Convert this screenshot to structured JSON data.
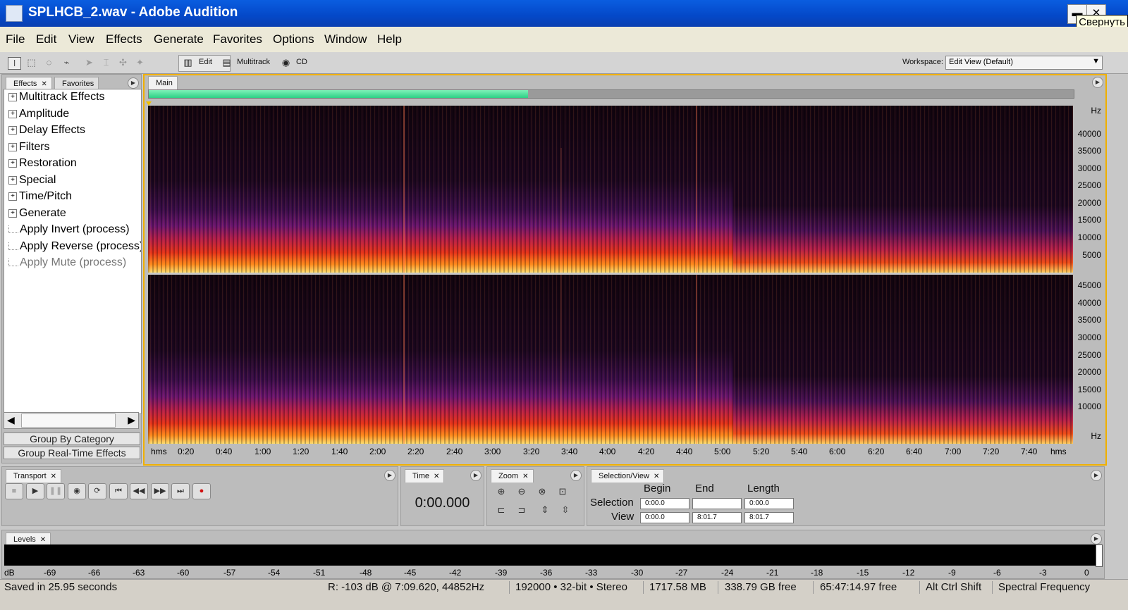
{
  "window": {
    "title": "SPLHCB_2.wav - Adobe Audition",
    "minimize_tooltip": "Свернуть"
  },
  "menu": [
    "File",
    "Edit",
    "View",
    "Effects",
    "Generate",
    "Favorites",
    "Options",
    "Window",
    "Help"
  ],
  "toolbar": {
    "edit_label": "Edit",
    "multitrack_label": "Multitrack",
    "cd_label": "CD",
    "workspace_label": "Workspace:",
    "workspace_value": "Edit View (Default)"
  },
  "effects_panel": {
    "tabs": [
      "Effects",
      "Favorites"
    ],
    "tree": [
      {
        "label": "Multitrack Effects",
        "expandable": true
      },
      {
        "label": "Amplitude",
        "expandable": true
      },
      {
        "label": "Delay Effects",
        "expandable": true
      },
      {
        "label": "Filters",
        "expandable": true
      },
      {
        "label": "Restoration",
        "expandable": true
      },
      {
        "label": "Special",
        "expandable": true
      },
      {
        "label": "Time/Pitch",
        "expandable": true
      },
      {
        "label": "Generate",
        "expandable": true
      },
      {
        "label": "Apply Invert (process)",
        "expandable": false
      },
      {
        "label": "Apply Reverse (process)",
        "expandable": false
      },
      {
        "label": "Apply Mute (process)",
        "expandable": false,
        "disabled": true
      }
    ],
    "group_by_category": "Group By Category",
    "group_realtime": "Group Real-Time Effects"
  },
  "main_panel": {
    "tab": "Main",
    "overview_progress": 0.41,
    "hz_unit": "Hz",
    "top_channel_hz": [
      "40000",
      "35000",
      "30000",
      "25000",
      "20000",
      "15000",
      "10000",
      "5000"
    ],
    "bottom_channel_hz": [
      "45000",
      "40000",
      "35000",
      "30000",
      "25000",
      "20000",
      "15000",
      "10000"
    ],
    "timeline": [
      "hms",
      "0:20",
      "0:40",
      "1:00",
      "1:20",
      "1:40",
      "2:00",
      "2:20",
      "2:40",
      "3:00",
      "3:20",
      "3:40",
      "4:00",
      "4:20",
      "4:40",
      "5:00",
      "5:20",
      "5:40",
      "6:00",
      "6:20",
      "6:40",
      "7:00",
      "7:20",
      "7:40",
      "hms"
    ]
  },
  "transport": {
    "tab": "Transport"
  },
  "time_panel": {
    "tab": "Time",
    "value": "0:00.000"
  },
  "zoom_panel": {
    "tab": "Zoom"
  },
  "selection_view": {
    "tab": "Selection/View",
    "headers": [
      "Begin",
      "End",
      "Length"
    ],
    "selection_label": "Selection",
    "view_label": "View",
    "selection": [
      "0:00.0",
      "",
      "0:00.0"
    ],
    "view": [
      "0:00.0",
      "8:01.7",
      "8:01.7"
    ]
  },
  "levels": {
    "tab": "Levels",
    "scale": [
      "dB",
      "-69",
      "-66",
      "-63",
      "-60",
      "-57",
      "-54",
      "-51",
      "-48",
      "-45",
      "-42",
      "-39",
      "-36",
      "-33",
      "-30",
      "-27",
      "-24",
      "-21",
      "-18",
      "-15",
      "-12",
      "-9",
      "-6",
      "-3",
      "0"
    ]
  },
  "status": {
    "saved": "Saved in 25.95 seconds",
    "cursor": "R: -103 dB @   7:09.620, 44852Hz",
    "format": "192000 • 32-bit • Stereo",
    "size": "1717.58 MB",
    "free_disk": "338.79 GB free",
    "free_time": "65:47:14.97 free",
    "keys": "Alt Ctrl Shift",
    "view_mode": "Spectral Frequency"
  }
}
